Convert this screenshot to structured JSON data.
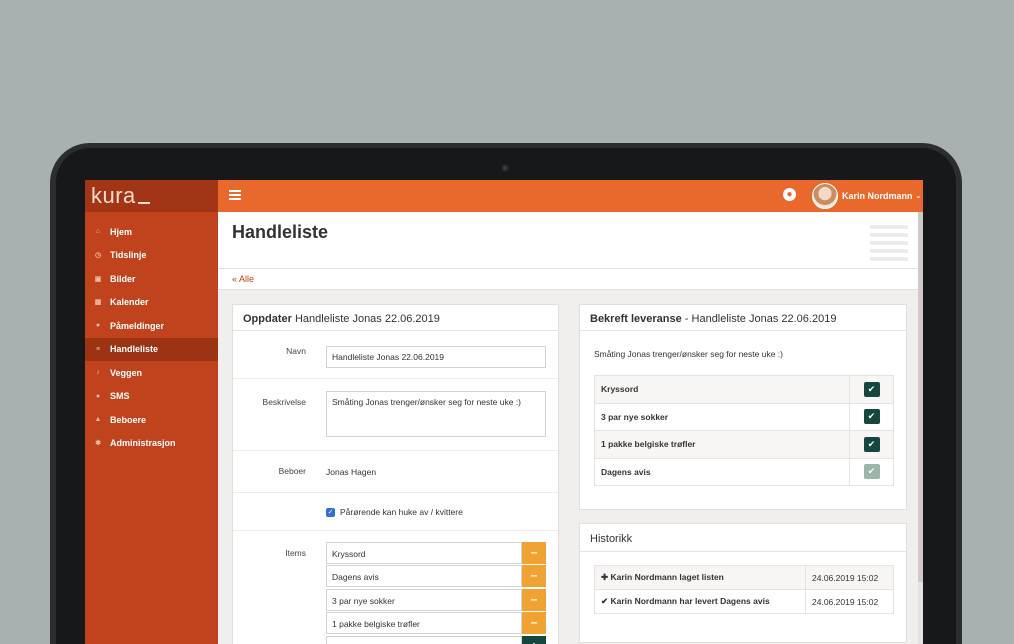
{
  "app": {
    "brand": "kura"
  },
  "sidebar": {
    "items": [
      {
        "label": "Hjem",
        "icon": "home-icon",
        "glyph": "⌂"
      },
      {
        "label": "Tidslinje",
        "icon": "clock-icon",
        "glyph": "◷"
      },
      {
        "label": "Bilder",
        "icon": "image-icon",
        "glyph": "▣"
      },
      {
        "label": "Kalender",
        "icon": "calendar-icon",
        "glyph": "▦"
      },
      {
        "label": "Påmeldinger",
        "icon": "users-icon",
        "glyph": "●"
      },
      {
        "label": "Handleliste",
        "icon": "list-icon",
        "glyph": "≡"
      },
      {
        "label": "Veggen",
        "icon": "microphone-icon",
        "glyph": "♪"
      },
      {
        "label": "SMS",
        "icon": "chat-icon",
        "glyph": "●"
      },
      {
        "label": "Beboere",
        "icon": "user-icon",
        "glyph": "▲"
      },
      {
        "label": "Administrasjon",
        "icon": "gear-icon",
        "glyph": "✱"
      }
    ],
    "active": "Handleliste"
  },
  "topbar": {
    "user_name": "Karin Nordmann"
  },
  "page": {
    "title": "Handleliste",
    "breadcrumb": "« Alle"
  },
  "form": {
    "heading_bold": "Oppdater",
    "heading_rest": "Handleliste Jonas 22.06.2019",
    "name_label": "Navn",
    "name_value": "Handleliste Jonas 22.06.2019",
    "desc_label": "Beskrivelse",
    "desc_value": "Småting Jonas trenger/ønsker seg for neste uke :)",
    "resident_label": "Beboer",
    "resident_value": "Jonas Hagen",
    "checkbox_label": "Pårørende kan huke av / kvittere",
    "items_label": "Items",
    "items": [
      "Kryssord",
      "Dagens avis",
      "3 par nye sokker",
      "1 pakke belgiske trøfler"
    ]
  },
  "delivery": {
    "heading_bold": "Bekreft leveranse",
    "heading_rest": " - Handleliste Jonas 22.06.2019",
    "description": "Småting Jonas trenger/ønsker seg for neste uke :)",
    "items": [
      {
        "label": "Kryssord",
        "checked": true
      },
      {
        "label": "3 par nye sokker",
        "checked": true
      },
      {
        "label": "1 pakke belgiske trøfler",
        "checked": true
      },
      {
        "label": "Dagens avis",
        "checked": true
      }
    ]
  },
  "history": {
    "heading": "Historikk",
    "entries": [
      {
        "text": "Karin Nordmann laget listen",
        "date": "24.06.2019 15:02"
      },
      {
        "text": "Karin Nordmann har levert Dagens avis",
        "date": "24.06.2019 15:02"
      }
    ]
  },
  "colors": {
    "sidebar": "#c0431d",
    "topbar": "#e8692b",
    "accent_green": "#16473e",
    "warning": "#f0a233"
  }
}
